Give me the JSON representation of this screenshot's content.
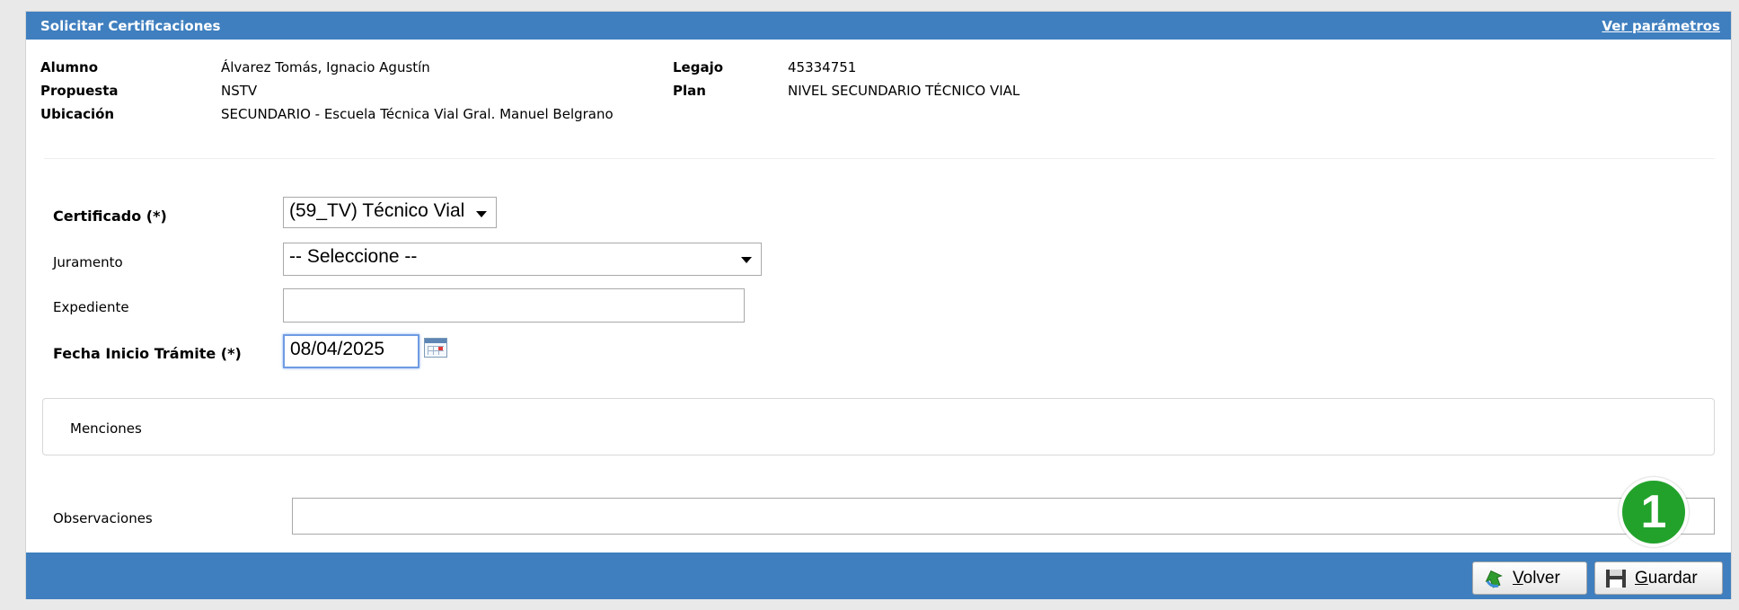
{
  "window": {
    "title": "Solicitar Certificaciones",
    "params_link": "Ver parámetros"
  },
  "student": {
    "alumno_label": "Alumno",
    "alumno": "Álvarez Tomás, Ignacio Agustín",
    "propuesta_label": "Propuesta",
    "propuesta": "NSTV",
    "ubicacion_label": "Ubicación",
    "ubicacion": "SECUNDARIO - Escuela Técnica Vial Gral. Manuel Belgrano",
    "legajo_label": "Legajo",
    "legajo": "45334751",
    "plan_label": "Plan",
    "plan": "NIVEL SECUNDARIO TÉCNICO VIAL"
  },
  "form": {
    "certificado_label": "Certificado (*)",
    "certificado_value": "(59_TV) Técnico Vial",
    "juramento_label": "Juramento",
    "juramento_value": "-- Seleccione --",
    "expediente_label": "Expediente",
    "expediente_value": "",
    "fecha_label": "Fecha Inicio Trámite (*)",
    "fecha_value": "08/04/2025",
    "menciones_label": "Menciones",
    "observaciones_label": "Observaciones",
    "observaciones_value": ""
  },
  "annotation": {
    "step": "1",
    "color": "#22a22b"
  },
  "footer": {
    "volver_first": "V",
    "volver_rest": "olver",
    "guardar_first": "G",
    "guardar_rest": "uardar"
  },
  "colors": {
    "header": "#3f7fbf",
    "focus_border": "#6f9be3"
  },
  "icons": [
    "back-arrow-icon",
    "save-disk-icon",
    "calendar-icon",
    "dropdown-caret-icon"
  ]
}
